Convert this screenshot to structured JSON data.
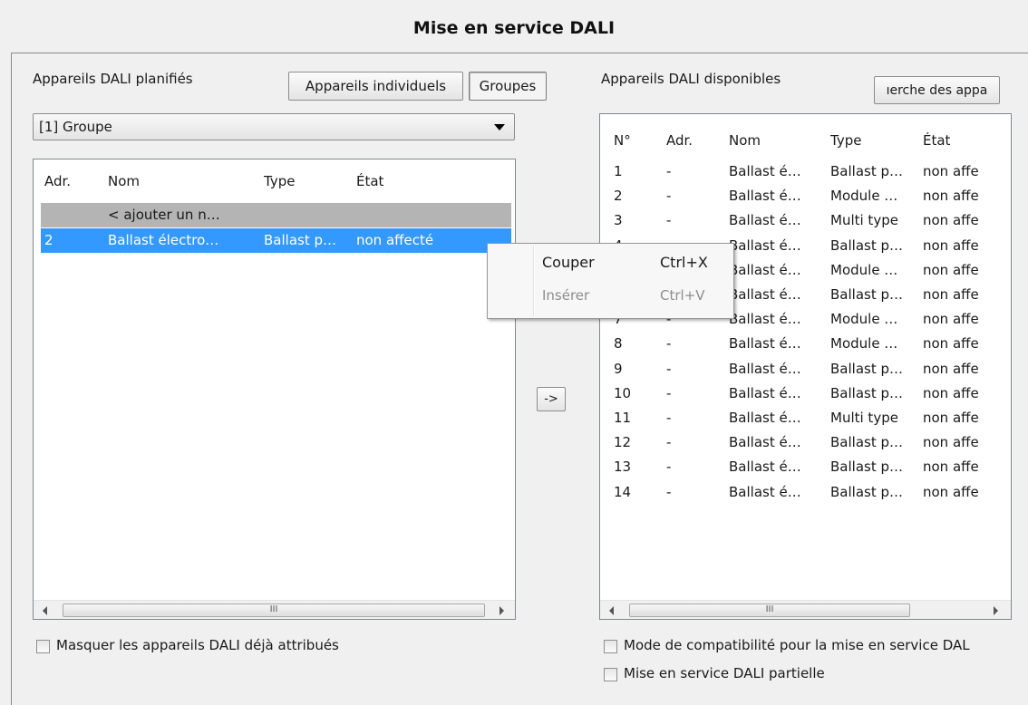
{
  "title": "Mise en service DALI",
  "planned": {
    "label": "Appareils DALI planifiés",
    "btn_individual": "Appareils individuels",
    "btn_groups": "Groupes",
    "group_select": "[1] Groupe",
    "columns": [
      "Adr.",
      "Nom",
      "Type",
      "État"
    ],
    "rows": [
      {
        "adr": "",
        "nom": "< ajouter un n…",
        "type": "",
        "etat": "",
        "state": "placeholder"
      },
      {
        "adr": "2",
        "nom": "Ballast électro…",
        "type": "Ballast p…",
        "etat": "non affecté",
        "state": "selected"
      }
    ],
    "scroll_grip": "III",
    "hide_assigned_label": "Masquer les appareils DALI déjà attribués"
  },
  "transfer_btn": "->",
  "available": {
    "label": "Appareils DALI disponibles",
    "search_btn": "ıerche des appa",
    "columns": [
      "N°",
      "Adr.",
      "Nom",
      "Type",
      "État"
    ],
    "rows": [
      {
        "n": "1",
        "adr": "-",
        "nom": "Ballast é…",
        "type": "Ballast p…",
        "etat": "non affe"
      },
      {
        "n": "2",
        "adr": "-",
        "nom": "Ballast é…",
        "type": "Module …",
        "etat": "non affe"
      },
      {
        "n": "3",
        "adr": "-",
        "nom": "Ballast é…",
        "type": "Multi type",
        "etat": "non affe"
      },
      {
        "n": "4",
        "adr": "-",
        "nom": "Ballast é…",
        "type": "Ballast p…",
        "etat": "non affe"
      },
      {
        "n": "5",
        "adr": "-",
        "nom": "Ballast é…",
        "type": "Module …",
        "etat": "non affe"
      },
      {
        "n": "6",
        "adr": "-",
        "nom": "Ballast é…",
        "type": "Ballast p…",
        "etat": "non affe"
      },
      {
        "n": "7",
        "adr": "-",
        "nom": "Ballast é…",
        "type": "Module …",
        "etat": "non affe"
      },
      {
        "n": "8",
        "adr": "-",
        "nom": "Ballast é…",
        "type": "Module …",
        "etat": "non affe"
      },
      {
        "n": "9",
        "adr": "-",
        "nom": "Ballast é…",
        "type": "Ballast p…",
        "etat": "non affe"
      },
      {
        "n": "10",
        "adr": "-",
        "nom": "Ballast é…",
        "type": "Ballast p…",
        "etat": "non affe"
      },
      {
        "n": "11",
        "adr": "-",
        "nom": "Ballast é…",
        "type": "Multi type",
        "etat": "non affe"
      },
      {
        "n": "12",
        "adr": "-",
        "nom": "Ballast é…",
        "type": "Ballast p…",
        "etat": "non affe"
      },
      {
        "n": "13",
        "adr": "-",
        "nom": "Ballast é…",
        "type": "Ballast p…",
        "etat": "non affe"
      },
      {
        "n": "14",
        "adr": "-",
        "nom": "Ballast é…",
        "type": "Ballast p…",
        "etat": "non affe"
      }
    ],
    "scroll_grip": "III",
    "compat_label": "Mode de compatibilité pour la mise en service DAL",
    "partial_label": "Mise en service DALI partielle"
  },
  "context_menu": {
    "items": [
      {
        "label": "Couper",
        "shortcut": "Ctrl+X",
        "enabled": true
      },
      {
        "label": "Insérer",
        "shortcut": "Ctrl+V",
        "enabled": false
      }
    ]
  },
  "colors": {
    "selection": "#3399ff",
    "placeholder_row": "#b4b4b4",
    "disabled_text": "#8d8d8d"
  }
}
